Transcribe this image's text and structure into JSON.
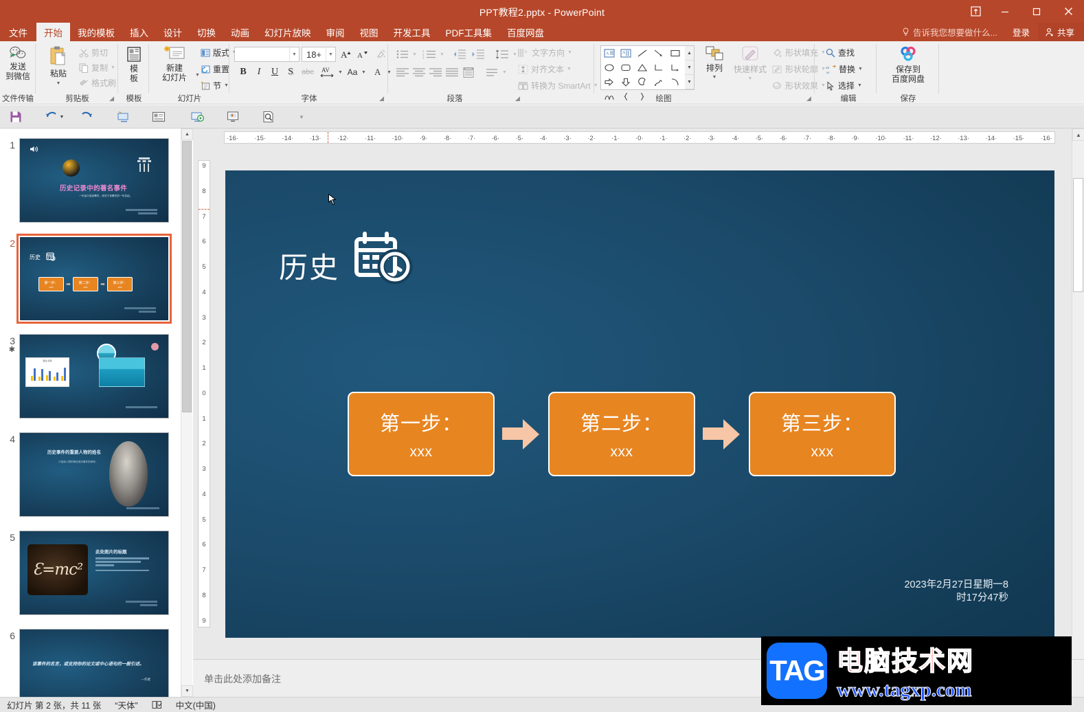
{
  "window": {
    "title": "PPT教程2.pptx - PowerPoint",
    "ribbon_display_icon": "ribbon-display-options-icon",
    "minimize": "minimize-icon",
    "maximize": "maximize-icon",
    "close": "close-icon"
  },
  "menu": {
    "items": [
      {
        "label": "文件",
        "active": false
      },
      {
        "label": "开始",
        "active": true
      },
      {
        "label": "我的模板",
        "active": false
      },
      {
        "label": "插入",
        "active": false
      },
      {
        "label": "设计",
        "active": false
      },
      {
        "label": "切换",
        "active": false
      },
      {
        "label": "动画",
        "active": false
      },
      {
        "label": "幻灯片放映",
        "active": false
      },
      {
        "label": "审阅",
        "active": false
      },
      {
        "label": "视图",
        "active": false
      },
      {
        "label": "开发工具",
        "active": false
      },
      {
        "label": "PDF工具集",
        "active": false
      },
      {
        "label": "百度网盘",
        "active": false
      }
    ],
    "tell_me": "告诉我您想要做什么...",
    "sign_in": "登录",
    "share": "共享"
  },
  "ribbon": {
    "groups": [
      {
        "name": "文件传输"
      },
      {
        "name": "剪贴板"
      },
      {
        "name": "模板"
      },
      {
        "name": "幻灯片"
      },
      {
        "name": "字体"
      },
      {
        "name": "段落"
      },
      {
        "name": "绘图"
      },
      {
        "name": "编辑"
      },
      {
        "name": "保存"
      }
    ],
    "wechat_send": "发送\n到微信",
    "wechat_send_l1": "发送",
    "wechat_send_l2": "到微信",
    "paste": "粘贴",
    "cut": "剪切",
    "copy": "复制",
    "format_painter": "格式刷",
    "template_l1": "模",
    "template_l2": "板",
    "new_slide_l1": "新建",
    "new_slide_l2": "幻灯片",
    "layout": "版式",
    "reset": "重置",
    "section": "节",
    "font_name": "",
    "font_name_placeholder": "",
    "font_size": "18+",
    "grow_font": "A",
    "shrink_font": "A",
    "clear_format": "clear-formatting-icon",
    "bold": "B",
    "italic": "I",
    "underline": "U",
    "shadow": "S",
    "strikethrough": "abc",
    "char_spacing": "AV",
    "change_case": "Aa",
    "font_color": "A",
    "text_direction": "文字方向",
    "align_text": "对齐文本",
    "convert_smartart": "转换为 SmartArt",
    "arrange_l1": "排列",
    "quick_styles_l1": "快速样式",
    "shape_fill": "形状填充",
    "shape_outline": "形状轮廓",
    "shape_effects": "形状效果",
    "find": "查找",
    "replace": "替换",
    "select": "选择",
    "save_baidu_l1": "保存到",
    "save_baidu_l2": "百度网盘"
  },
  "qat": {
    "buttons": [
      {
        "name": "save-icon"
      },
      {
        "name": "undo-icon"
      },
      {
        "name": "undo-dropdown-icon"
      },
      {
        "name": "redo-icon"
      },
      {
        "name": "start-from-beginning-icon"
      },
      {
        "name": "new-slide-qat-icon"
      },
      {
        "name": "slideshow-icon"
      },
      {
        "name": "presenter-view-icon"
      },
      {
        "name": "print-preview-icon"
      },
      {
        "name": "customize-qat-icon"
      }
    ]
  },
  "thumbnails": [
    {
      "number": "1",
      "starred": false,
      "selected": false,
      "kind": "title"
    },
    {
      "number": "2",
      "starred": false,
      "selected": true,
      "kind": "steps"
    },
    {
      "number": "3",
      "starred": true,
      "selected": false,
      "kind": "chart"
    },
    {
      "number": "4",
      "starred": false,
      "selected": false,
      "kind": "portrait"
    },
    {
      "number": "5",
      "starred": false,
      "selected": false,
      "kind": "photo"
    },
    {
      "number": "6",
      "starred": false,
      "selected": false,
      "kind": "quote"
    }
  ],
  "thumb_texts": {
    "s1_title": "历史记录中的著名事件",
    "s1_sub": "一句话介绍该事件，或关于该事件的一句总结。",
    "s2_title": "历史",
    "s4_title": "历史事件的重要人物的姓名",
    "s4_sub": "介绍该人物的角色或对事件的参考。",
    "s5_title": "此处照片的标题",
    "s6_quote": "该事件的名言，或支持你的论文或中心语句的一般引述。",
    "s6_author": "—作者"
  },
  "rulers": {
    "horizontal": [
      "16",
      "15",
      "14",
      "13",
      "12",
      "11",
      "10",
      "9",
      "8",
      "7",
      "6",
      "5",
      "4",
      "3",
      "2",
      "1",
      "0",
      "1",
      "2",
      "3",
      "4",
      "5",
      "6",
      "7",
      "8",
      "9",
      "10",
      "11",
      "12",
      "13",
      "14",
      "15",
      "16"
    ],
    "vertical": [
      "9",
      "8",
      "7",
      "6",
      "5",
      "4",
      "3",
      "2",
      "1",
      "0",
      "1",
      "2",
      "3",
      "4",
      "5",
      "6",
      "7",
      "8",
      "9"
    ]
  },
  "slide": {
    "title": "历史",
    "title_icon": "calendar-clock-icon",
    "steps": [
      {
        "heading": "第一步：",
        "body": "xxx"
      },
      {
        "heading": "第二步：",
        "body": "xxx"
      },
      {
        "heading": "第三步：",
        "body": "xxx"
      }
    ],
    "arrow_icon": "right-arrow-icon",
    "date_line1": "2023年2月27日星期一8",
    "date_line2": "时17分47秒",
    "colors": {
      "background": "#16405c",
      "step_fill": "#e78521",
      "step_border": "#ffffff",
      "arrow": "#f6c6a6"
    }
  },
  "notes": {
    "placeholder": "单击此处添加备注"
  },
  "status": {
    "slide_count": "幻灯片 第 2 张，共 11 张",
    "theme": "“天体”",
    "spellcheck_icon": "spellcheck-icon",
    "language": "中文(中国)"
  },
  "watermark": {
    "logo": "TAG",
    "name": "电脑技术网",
    "url": "www.tagxp.com"
  }
}
